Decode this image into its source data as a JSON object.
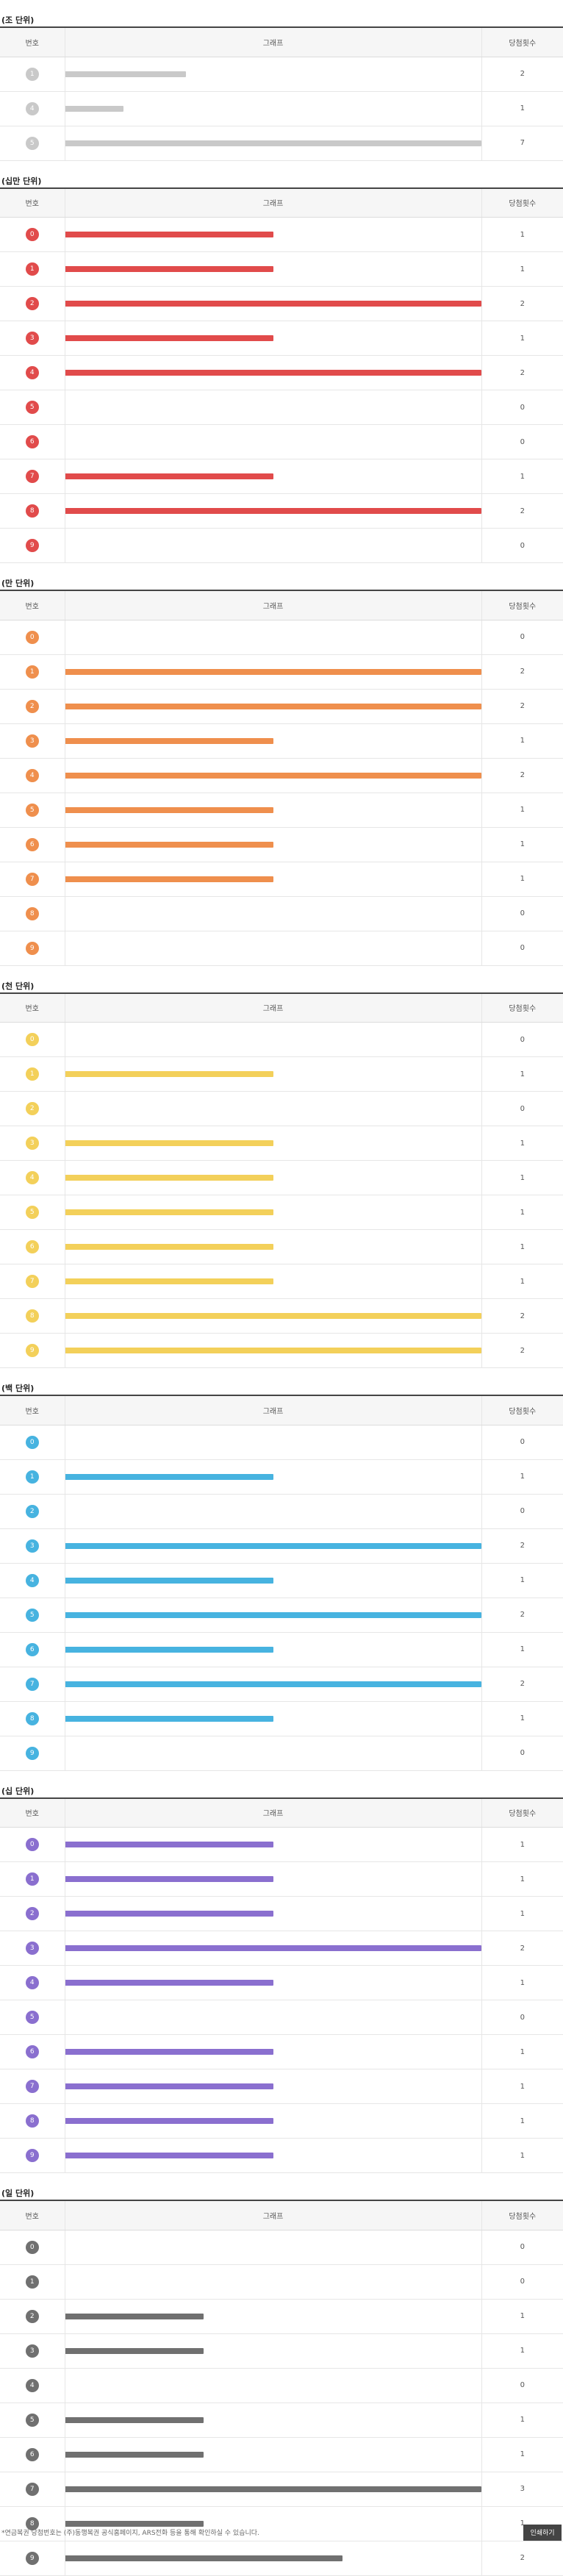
{
  "headers": {
    "num": "번호",
    "graph": "그래프",
    "count": "당첨횟수"
  },
  "max_count": 2,
  "sections": [
    {
      "key": "jo",
      "title": "(조 단위)",
      "color": "#c9c9c9",
      "rows": [
        {
          "label": "1",
          "count": 2
        },
        {
          "label": "4",
          "count": 1
        },
        {
          "label": "5",
          "count": 7
        }
      ],
      "bar_fractions": [
        0.29,
        0.14,
        1.0
      ]
    },
    {
      "key": "sipman",
      "title": "(십만 단위)",
      "color": "#e14b4b",
      "rows": [
        {
          "label": "0",
          "count": 1
        },
        {
          "label": "1",
          "count": 1
        },
        {
          "label": "2",
          "count": 2
        },
        {
          "label": "3",
          "count": 1
        },
        {
          "label": "4",
          "count": 2
        },
        {
          "label": "5",
          "count": 0
        },
        {
          "label": "6",
          "count": 0
        },
        {
          "label": "7",
          "count": 1
        },
        {
          "label": "8",
          "count": 2
        },
        {
          "label": "9",
          "count": 0
        }
      ]
    },
    {
      "key": "man",
      "title": "(만 단위)",
      "color": "#ef8f4d",
      "rows": [
        {
          "label": "0",
          "count": 0
        },
        {
          "label": "1",
          "count": 2
        },
        {
          "label": "2",
          "count": 2
        },
        {
          "label": "3",
          "count": 1
        },
        {
          "label": "4",
          "count": 2
        },
        {
          "label": "5",
          "count": 1
        },
        {
          "label": "6",
          "count": 1
        },
        {
          "label": "7",
          "count": 1
        },
        {
          "label": "8",
          "count": 0
        },
        {
          "label": "9",
          "count": 0
        }
      ]
    },
    {
      "key": "cheon",
      "title": "(천 단위)",
      "color": "#f3d05a",
      "rows": [
        {
          "label": "0",
          "count": 0
        },
        {
          "label": "1",
          "count": 1
        },
        {
          "label": "2",
          "count": 0
        },
        {
          "label": "3",
          "count": 1
        },
        {
          "label": "4",
          "count": 1
        },
        {
          "label": "5",
          "count": 1
        },
        {
          "label": "6",
          "count": 1
        },
        {
          "label": "7",
          "count": 1
        },
        {
          "label": "8",
          "count": 2
        },
        {
          "label": "9",
          "count": 2
        }
      ]
    },
    {
      "key": "baek",
      "title": "(백 단위)",
      "color": "#47b3e0",
      "rows": [
        {
          "label": "0",
          "count": 0
        },
        {
          "label": "1",
          "count": 1
        },
        {
          "label": "2",
          "count": 0
        },
        {
          "label": "3",
          "count": 2
        },
        {
          "label": "4",
          "count": 1
        },
        {
          "label": "5",
          "count": 2
        },
        {
          "label": "6",
          "count": 1
        },
        {
          "label": "7",
          "count": 2
        },
        {
          "label": "8",
          "count": 1
        },
        {
          "label": "9",
          "count": 0
        }
      ]
    },
    {
      "key": "sip",
      "title": "(십 단위)",
      "color": "#8a6fcf",
      "rows": [
        {
          "label": "0",
          "count": 1
        },
        {
          "label": "1",
          "count": 1
        },
        {
          "label": "2",
          "count": 1
        },
        {
          "label": "3",
          "count": 2
        },
        {
          "label": "4",
          "count": 1
        },
        {
          "label": "5",
          "count": 0
        },
        {
          "label": "6",
          "count": 1
        },
        {
          "label": "7",
          "count": 1
        },
        {
          "label": "8",
          "count": 1
        },
        {
          "label": "9",
          "count": 1
        }
      ]
    },
    {
      "key": "il",
      "title": "(일 단위)",
      "color": "#707070",
      "rows": [
        {
          "label": "0",
          "count": 0
        },
        {
          "label": "1",
          "count": 0
        },
        {
          "label": "2",
          "count": 1
        },
        {
          "label": "3",
          "count": 1
        },
        {
          "label": "4",
          "count": 0
        },
        {
          "label": "5",
          "count": 1
        },
        {
          "label": "6",
          "count": 1
        },
        {
          "label": "7",
          "count": 3
        },
        {
          "label": "8",
          "count": 1
        },
        {
          "label": "9",
          "count": 2
        }
      ],
      "max": 3
    }
  ],
  "footer": {
    "note": "*연금복권 당첨번호는 (주)동행복권 공식홈페이지, ARS전화 등을 통해 확인하실 수 있습니다.",
    "print_label": "인쇄하기"
  }
}
